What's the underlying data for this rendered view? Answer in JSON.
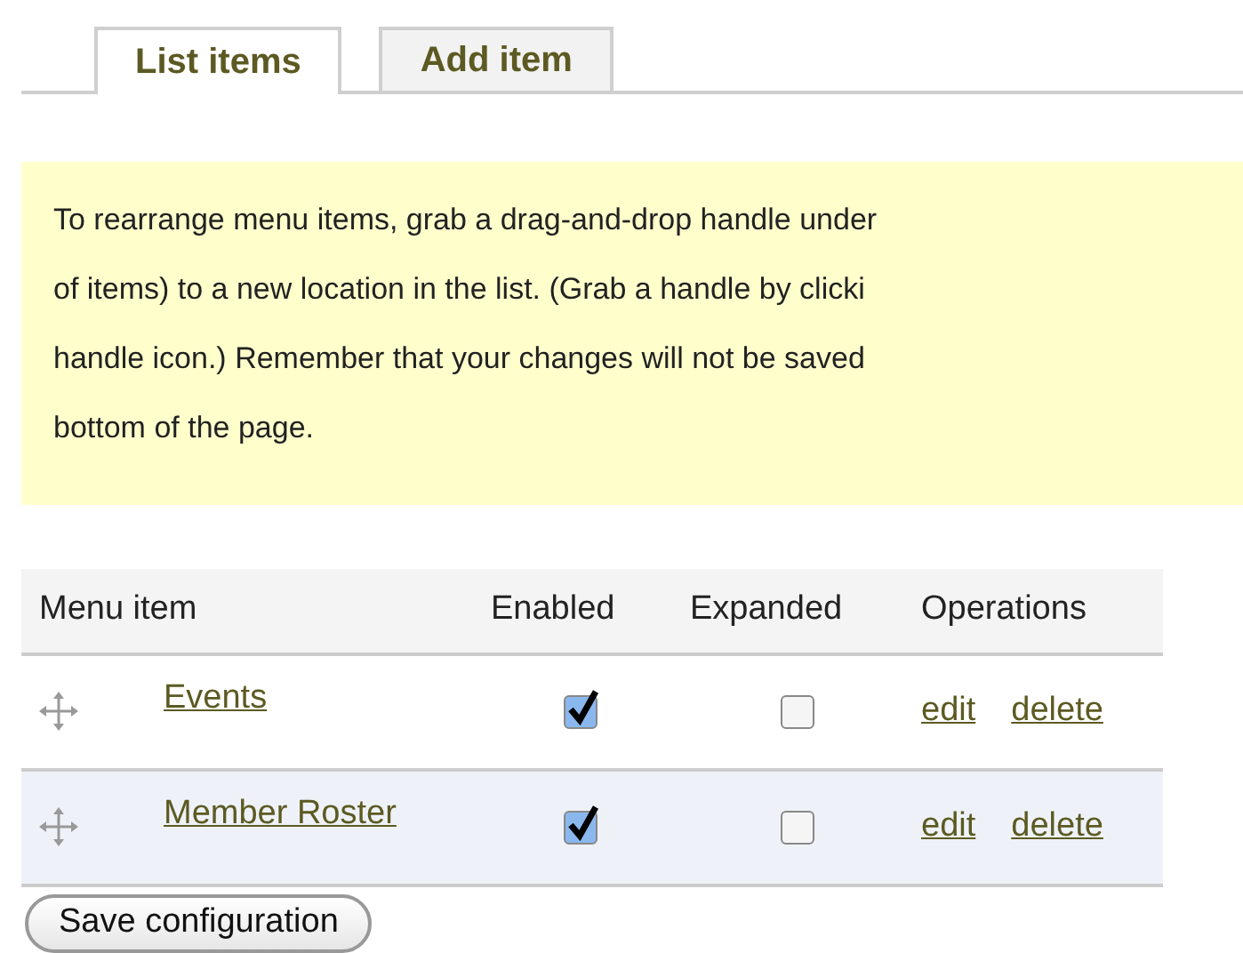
{
  "tabs": [
    {
      "label": "List items",
      "selected": true
    },
    {
      "label": "Add item",
      "selected": false
    }
  ],
  "message": {
    "lines": [
      "To rearrange menu items, grab a drag-and-drop handle under",
      "of items) to a new location in the list. (Grab a handle by clicki",
      "handle icon.) Remember that your changes will not be saved",
      "bottom of the page."
    ]
  },
  "table": {
    "columns": [
      "Menu item",
      "Enabled",
      "Expanded",
      "Operations"
    ],
    "rows": [
      {
        "title": "Events",
        "enabled": true,
        "expanded": false,
        "operations": [
          "edit",
          "delete"
        ]
      },
      {
        "title": "Member Roster",
        "enabled": true,
        "expanded": false,
        "operations": [
          "edit",
          "delete"
        ]
      }
    ]
  },
  "save_button": "Save configuration"
}
